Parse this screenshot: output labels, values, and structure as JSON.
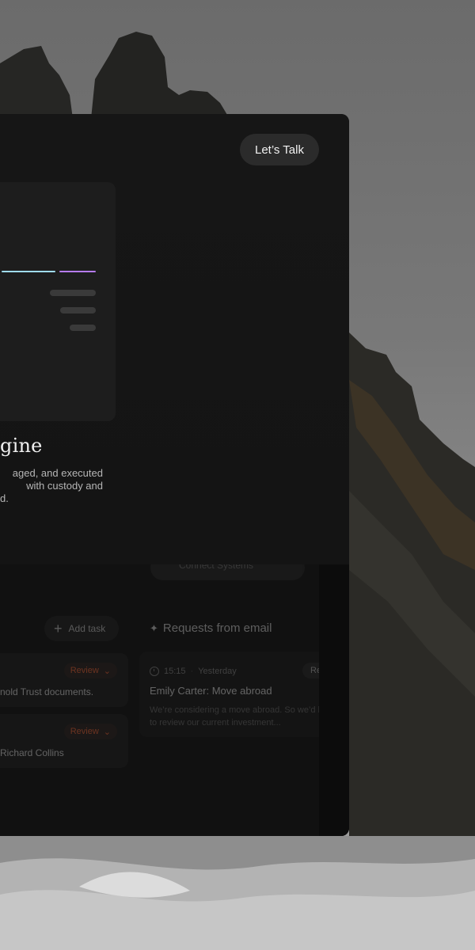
{
  "header": {
    "cta_label": "Let’s Talk"
  },
  "hero": {
    "heading": "gine",
    "description_lines": [
      "aged, and executed",
      "with custody and",
      "d."
    ]
  },
  "hidden_pill": {
    "label": "Connect Systems"
  },
  "tasks": {
    "add_label": "Add task",
    "items": [
      {
        "status": "Review",
        "text": "nold Trust documents."
      },
      {
        "status": "Review",
        "text": "Richard Collins"
      }
    ]
  },
  "requests": {
    "title": "Requests from email",
    "email": {
      "time": "15:15",
      "day": "Yesterday",
      "badge": "Rev",
      "subject": "Emily Carter: Move abroad",
      "body": "We’re considering a move abroad. So we’d like to review our current investment..."
    }
  },
  "colors": {
    "accent_cyan": "#9fdcf0",
    "accent_purple": "#b57bf0",
    "status_review": "#ff6a3a"
  }
}
